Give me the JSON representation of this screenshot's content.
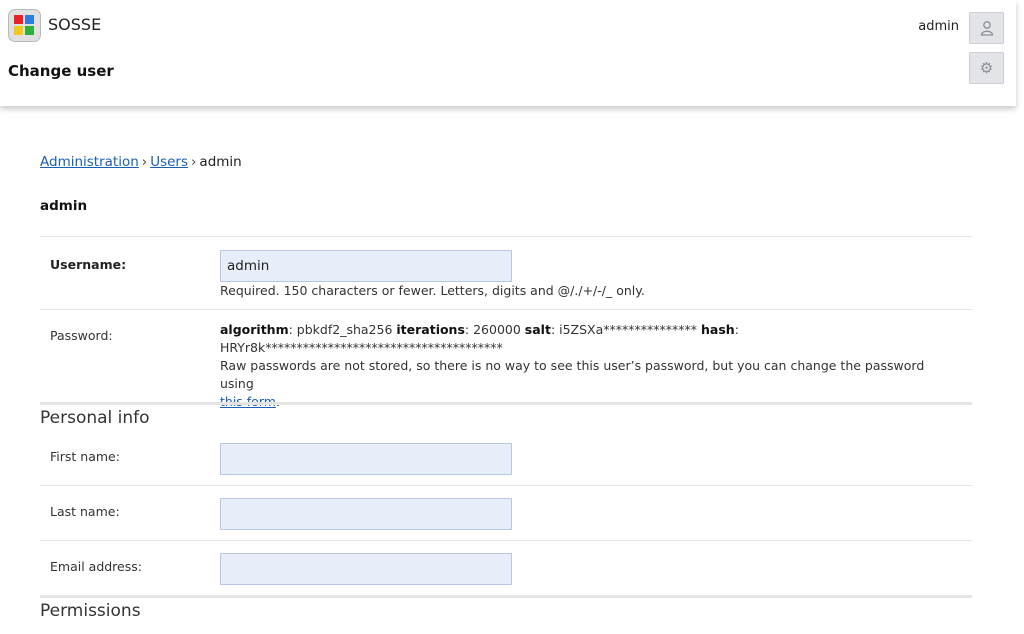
{
  "header": {
    "brand": "SOSSE",
    "page_title": "Change user",
    "username": "admin",
    "logo_icon": "sosse-logo-icon",
    "user_icon": "user-icon",
    "settings_icon": "gear-icon"
  },
  "breadcrumb": {
    "items": [
      "Administration",
      "Users"
    ],
    "current": "admin",
    "separator": "›"
  },
  "object_title": "admin",
  "form": {
    "username": {
      "label": "Username:",
      "value": "admin",
      "help": "Required. 150 characters or fewer. Letters, digits and @/./+/-/_ only."
    },
    "password": {
      "label": "Password:",
      "algorithm_label": "algorithm",
      "algorithm_value": ": pbkdf2_sha256 ",
      "iterations_label": "iterations",
      "iterations_value": ": 260000 ",
      "salt_label": "salt",
      "salt_value": ": i5ZSXa*************** ",
      "hash_label": "hash",
      "hash_value": ": HRYr8k**************************************",
      "note": "Raw passwords are not stored, so there is no way to see this user’s password, but you can change the password using ",
      "link_text": "this form",
      "note_end": "."
    },
    "personal_info": {
      "title": "Personal info",
      "first_name_label": "First name:",
      "first_name_value": "",
      "last_name_label": "Last name:",
      "last_name_value": "",
      "email_label": "Email address:",
      "email_value": ""
    },
    "permissions": {
      "title": "Permissions"
    }
  }
}
